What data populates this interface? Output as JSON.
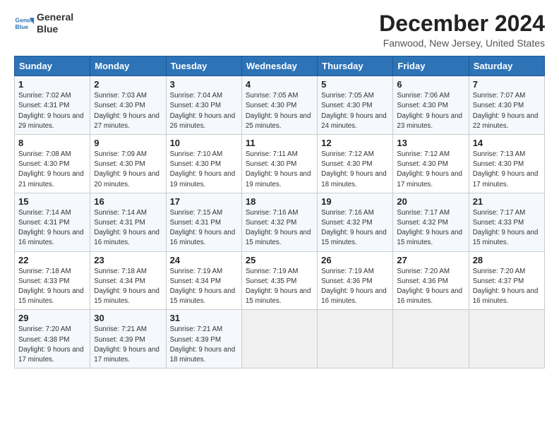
{
  "header": {
    "logo_line1": "General",
    "logo_line2": "Blue",
    "title": "December 2024",
    "subtitle": "Fanwood, New Jersey, United States"
  },
  "weekdays": [
    "Sunday",
    "Monday",
    "Tuesday",
    "Wednesday",
    "Thursday",
    "Friday",
    "Saturday"
  ],
  "weeks": [
    [
      {
        "day": "1",
        "sunrise": "7:02 AM",
        "sunset": "4:31 PM",
        "daylight": "9 hours and 29 minutes."
      },
      {
        "day": "2",
        "sunrise": "7:03 AM",
        "sunset": "4:30 PM",
        "daylight": "9 hours and 27 minutes."
      },
      {
        "day": "3",
        "sunrise": "7:04 AM",
        "sunset": "4:30 PM",
        "daylight": "9 hours and 26 minutes."
      },
      {
        "day": "4",
        "sunrise": "7:05 AM",
        "sunset": "4:30 PM",
        "daylight": "9 hours and 25 minutes."
      },
      {
        "day": "5",
        "sunrise": "7:05 AM",
        "sunset": "4:30 PM",
        "daylight": "9 hours and 24 minutes."
      },
      {
        "day": "6",
        "sunrise": "7:06 AM",
        "sunset": "4:30 PM",
        "daylight": "9 hours and 23 minutes."
      },
      {
        "day": "7",
        "sunrise": "7:07 AM",
        "sunset": "4:30 PM",
        "daylight": "9 hours and 22 minutes."
      }
    ],
    [
      {
        "day": "8",
        "sunrise": "7:08 AM",
        "sunset": "4:30 PM",
        "daylight": "9 hours and 21 minutes."
      },
      {
        "day": "9",
        "sunrise": "7:09 AM",
        "sunset": "4:30 PM",
        "daylight": "9 hours and 20 minutes."
      },
      {
        "day": "10",
        "sunrise": "7:10 AM",
        "sunset": "4:30 PM",
        "daylight": "9 hours and 19 minutes."
      },
      {
        "day": "11",
        "sunrise": "7:11 AM",
        "sunset": "4:30 PM",
        "daylight": "9 hours and 19 minutes."
      },
      {
        "day": "12",
        "sunrise": "7:12 AM",
        "sunset": "4:30 PM",
        "daylight": "9 hours and 18 minutes."
      },
      {
        "day": "13",
        "sunrise": "7:12 AM",
        "sunset": "4:30 PM",
        "daylight": "9 hours and 17 minutes."
      },
      {
        "day": "14",
        "sunrise": "7:13 AM",
        "sunset": "4:30 PM",
        "daylight": "9 hours and 17 minutes."
      }
    ],
    [
      {
        "day": "15",
        "sunrise": "7:14 AM",
        "sunset": "4:31 PM",
        "daylight": "9 hours and 16 minutes."
      },
      {
        "day": "16",
        "sunrise": "7:14 AM",
        "sunset": "4:31 PM",
        "daylight": "9 hours and 16 minutes."
      },
      {
        "day": "17",
        "sunrise": "7:15 AM",
        "sunset": "4:31 PM",
        "daylight": "9 hours and 16 minutes."
      },
      {
        "day": "18",
        "sunrise": "7:16 AM",
        "sunset": "4:32 PM",
        "daylight": "9 hours and 15 minutes."
      },
      {
        "day": "19",
        "sunrise": "7:16 AM",
        "sunset": "4:32 PM",
        "daylight": "9 hours and 15 minutes."
      },
      {
        "day": "20",
        "sunrise": "7:17 AM",
        "sunset": "4:32 PM",
        "daylight": "9 hours and 15 minutes."
      },
      {
        "day": "21",
        "sunrise": "7:17 AM",
        "sunset": "4:33 PM",
        "daylight": "9 hours and 15 minutes."
      }
    ],
    [
      {
        "day": "22",
        "sunrise": "7:18 AM",
        "sunset": "4:33 PM",
        "daylight": "9 hours and 15 minutes."
      },
      {
        "day": "23",
        "sunrise": "7:18 AM",
        "sunset": "4:34 PM",
        "daylight": "9 hours and 15 minutes."
      },
      {
        "day": "24",
        "sunrise": "7:19 AM",
        "sunset": "4:34 PM",
        "daylight": "9 hours and 15 minutes."
      },
      {
        "day": "25",
        "sunrise": "7:19 AM",
        "sunset": "4:35 PM",
        "daylight": "9 hours and 15 minutes."
      },
      {
        "day": "26",
        "sunrise": "7:19 AM",
        "sunset": "4:36 PM",
        "daylight": "9 hours and 16 minutes."
      },
      {
        "day": "27",
        "sunrise": "7:20 AM",
        "sunset": "4:36 PM",
        "daylight": "9 hours and 16 minutes."
      },
      {
        "day": "28",
        "sunrise": "7:20 AM",
        "sunset": "4:37 PM",
        "daylight": "9 hours and 16 minutes."
      }
    ],
    [
      {
        "day": "29",
        "sunrise": "7:20 AM",
        "sunset": "4:38 PM",
        "daylight": "9 hours and 17 minutes."
      },
      {
        "day": "30",
        "sunrise": "7:21 AM",
        "sunset": "4:39 PM",
        "daylight": "9 hours and 17 minutes."
      },
      {
        "day": "31",
        "sunrise": "7:21 AM",
        "sunset": "4:39 PM",
        "daylight": "9 hours and 18 minutes."
      },
      null,
      null,
      null,
      null
    ]
  ],
  "labels": {
    "sunrise": "Sunrise:",
    "sunset": "Sunset:",
    "daylight": "Daylight:"
  }
}
